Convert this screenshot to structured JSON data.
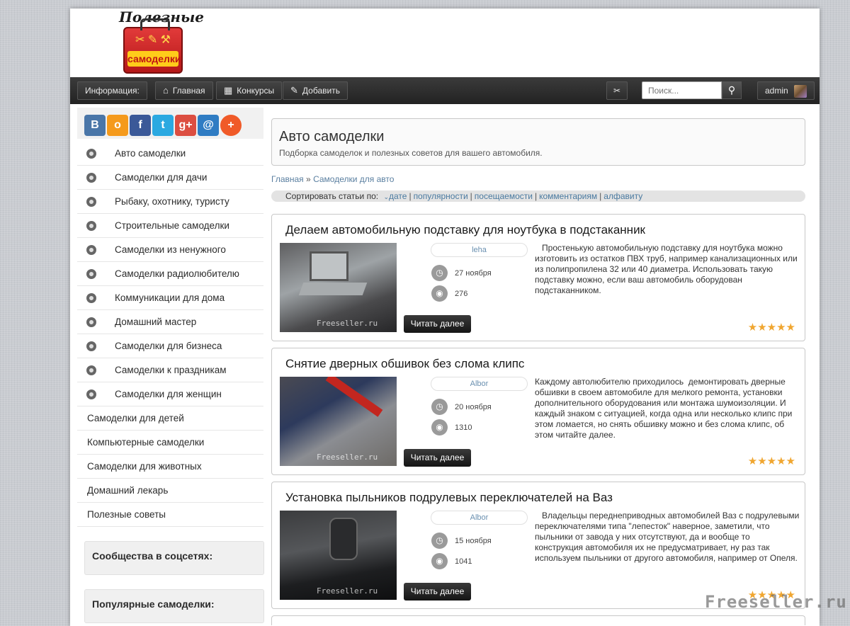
{
  "logo": {
    "title": "Полезные",
    "sub": "самоделки"
  },
  "navbar": {
    "info": "Информация:",
    "home": "Главная",
    "contests": "Конкурсы",
    "add": "Добавить",
    "search_placeholder": "Поиск...",
    "user": "admin"
  },
  "social": [
    "В",
    "о",
    "f",
    "t",
    "g+",
    "@",
    "+"
  ],
  "sidebar": {
    "items": [
      {
        "label": "Авто самоделки"
      },
      {
        "label": "Самоделки для дачи"
      },
      {
        "label": "Рыбаку, охотнику, туристу"
      },
      {
        "label": "Строительные самоделки"
      },
      {
        "label": "Самоделки из ненужного"
      },
      {
        "label": "Самоделки радиолюбителю"
      },
      {
        "label": "Коммуникации для дома"
      },
      {
        "label": "Домашний мастер"
      },
      {
        "label": "Самоделки для бизнеса"
      },
      {
        "label": "Самоделки к праздникам"
      },
      {
        "label": "Самоделки для женщин"
      },
      {
        "label": "Самоделки для детей"
      },
      {
        "label": "Компьютерные самоделки"
      },
      {
        "label": "Самоделки для животных"
      },
      {
        "label": "Домашний лекарь"
      },
      {
        "label": "Полезные советы"
      }
    ],
    "box1": "Сообщества в соцсетях:",
    "box2": "Популярные самоделки:"
  },
  "category": {
    "title": "Авто самоделки",
    "desc": "Подборка самоделок и полезных советов для вашего автомобиля."
  },
  "breadcrumb": {
    "home": "Главная",
    "sep": "»",
    "current": "Самоделки для авто"
  },
  "sort": {
    "label": "Сортировать статьи по:",
    "options": [
      "дате",
      "популярности",
      "посещаемости",
      "комментариям",
      "алфавиту"
    ]
  },
  "posts": [
    {
      "title": "Делаем автомобильную подставку для ноутбука в подстаканник",
      "author": "leha",
      "date": "27 ноября",
      "views": "276",
      "excerpt": "   Простенькую автомобильную подставку для ноутбука можно изготовить из остатков ПВХ труб, например канализационных или из полипропилена 32 или 40 диаметра. Использовать такую подставку можно, если ваш автомобиль оборудован подстаканником.",
      "read_more": "Читать далее",
      "rating": 5
    },
    {
      "title": "Снятие дверных обшивок без слома клипс",
      "author": "Albor",
      "date": "20 ноября",
      "views": "1310",
      "excerpt": "Каждому автолюбителю приходилось  демонтировать дверные обшивки в своем автомобиле для мелкого ремонта, установки дополнительного оборудования или монтажа шумоизоляции. И каждый знаком с ситуацией, когда одна или несколько клипс при этом ломается, но снять обшивку можно и без слома клипс, об этом читайте далее.",
      "read_more": "Читать далее",
      "rating": 5
    },
    {
      "title": "Установка пыльников подрулевых переключателей на Ваз",
      "author": "Albor",
      "date": "15 ноября",
      "views": "1041",
      "excerpt": "   Владельцы переднеприводных автомобилей Ваз с подрулевыми переключателями типа \"лепесток\" наверное, заметили, что пыльники от завода у них отсутствуют, да и вообще то конструкция автомобиля их не предусматривает, ну раз так используем пыльники от другого автомобиля, например от Опеля.",
      "read_more": "Читать далее",
      "rating": 5
    }
  ],
  "thumb_watermark": "Freeseller.ru",
  "watermark": "Freeseller.ru",
  "colors": {
    "accent": "#f0a630",
    "link": "#4a7aa0",
    "nav": "#2b2b2b"
  }
}
